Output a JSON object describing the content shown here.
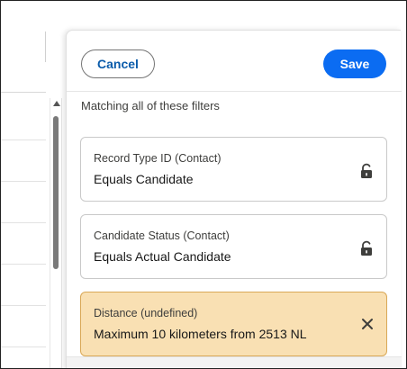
{
  "panel": {
    "cancel_label": "Cancel",
    "save_label": "Save",
    "section_label": "Matching all of these filters",
    "filters": [
      {
        "title": "Record Type ID (Contact)",
        "value": "Equals Candidate",
        "icon": "lock-icon"
      },
      {
        "title": "Candidate Status (Contact)",
        "value": "Equals Actual Candidate",
        "icon": "lock-icon"
      },
      {
        "title": "Distance (undefined)",
        "value": "Maximum 10 kilometers from 2513 NL",
        "icon": "close-icon"
      }
    ]
  },
  "colors": {
    "save_bg": "#0b6cf2",
    "cancel_text": "#0b5cab",
    "warning_bg": "#f9e0b3",
    "warning_border": "#d9a857"
  }
}
